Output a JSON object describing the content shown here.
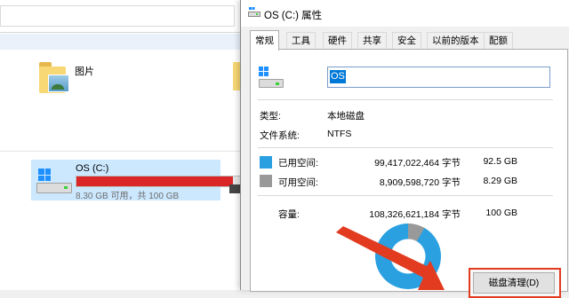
{
  "explorer": {
    "pictures_folder_label": "图片",
    "drive": {
      "name": "OS (C:)",
      "free_text": "8.30 GB 可用，共 100 GB",
      "used_fraction": 0.917,
      "bar_color": "#da2626"
    }
  },
  "dialog": {
    "title": "OS (C:) 属性",
    "tabs": [
      "常规",
      "工具",
      "硬件",
      "共享",
      "安全",
      "以前的版本",
      "配额"
    ],
    "active_tab": "常规",
    "volume_name": "OS",
    "type_label": "类型:",
    "type_value": "本地磁盘",
    "fs_label": "文件系统:",
    "fs_value": "NTFS",
    "used": {
      "label": "已用空间:",
      "bytes": "99,417,022,464 字节",
      "gb": "92.5 GB",
      "color": "#2aa0e0"
    },
    "free": {
      "label": "可用空间:",
      "bytes": "8,909,598,720 字节",
      "gb": "8.29 GB",
      "color": "#999999"
    },
    "capacity": {
      "label": "容量:",
      "bytes": "108,326,621,184 字节",
      "gb": "100 GB"
    },
    "cleanup_button_label": "磁盘清理(D)",
    "highlight_color": "#e23b1f"
  }
}
